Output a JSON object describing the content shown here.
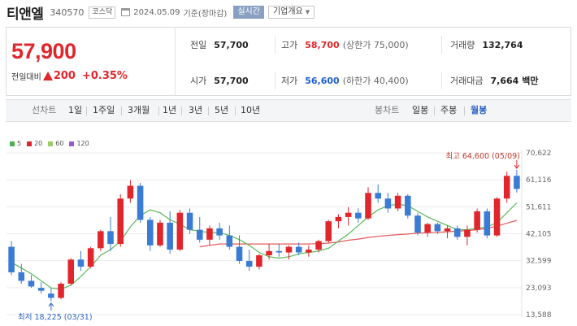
{
  "header": {
    "name": "티앤엘",
    "code": "340570",
    "market": "코스닥",
    "date": "2024.05.09",
    "basis": "기준(장마감)",
    "realtime_label": "실시간",
    "company_info_label": "기업개요"
  },
  "quote": {
    "price": "57,900",
    "change_label": "전일대비",
    "change": "200",
    "change_pct": "+0.35%",
    "prev_close_label": "전일",
    "prev_close": "57,700",
    "high_label": "고가",
    "high": "58,700",
    "upper_limit": "(상한가 75,000)",
    "volume_label": "거래량",
    "volume": "132,764",
    "open_label": "시가",
    "open": "57,700",
    "low_label": "저가",
    "low": "56,600",
    "lower_limit": "(하한가 40,400)",
    "amount_label": "거래대금",
    "amount": "7,664",
    "amount_unit": "백만"
  },
  "tabs": {
    "line_label": "선차트",
    "line_periods": [
      "1일",
      "1주일",
      "3개월",
      "1년",
      "3년",
      "5년",
      "10년"
    ],
    "candle_label": "봉차트",
    "candle_periods": [
      "일봉",
      "주봉",
      "월봉"
    ],
    "active_candle": "월봉"
  },
  "colors": {
    "up": "#e0262c",
    "down": "#3a7bd5",
    "accent": "#2b62c5",
    "ma5": "#4caf50",
    "ma20": "#e0262c",
    "ma60": "#9ccc65",
    "ma120": "#9c5bd1"
  },
  "chart_data": {
    "type": "candlestick",
    "legend": [
      {
        "name": "5",
        "color": "#4caf50"
      },
      {
        "name": "20",
        "color": "#e0262c"
      },
      {
        "name": "60",
        "color": "#9ccc65"
      },
      {
        "name": "120",
        "color": "#9c5bd1"
      }
    ],
    "y_ticks": [
      70622,
      61116,
      51611,
      42105,
      32599,
      23093,
      13588
    ],
    "y_tick_labels": [
      "70,622",
      "61,116",
      "51,611",
      "42,105",
      "32,599",
      "23,093",
      "13,588"
    ],
    "ylim": [
      13588,
      70622
    ],
    "high_annotation": "최고 64,600 (05/09)",
    "low_annotation": "최저 18,225 (03/31)",
    "candles": [
      [
        37500,
        39500,
        27500,
        28500
      ],
      [
        28500,
        31500,
        24500,
        25500
      ],
      [
        25500,
        27500,
        23000,
        23500
      ],
      [
        23000,
        25000,
        21000,
        22000
      ],
      [
        21000,
        23000,
        18225,
        19500
      ],
      [
        19500,
        25000,
        19000,
        24500
      ],
      [
        24500,
        33500,
        24000,
        33000
      ],
      [
        33000,
        36000,
        29000,
        30500
      ],
      [
        30500,
        37500,
        30000,
        37000
      ],
      [
        37000,
        43500,
        36000,
        43000
      ],
      [
        43000,
        48000,
        36000,
        38500
      ],
      [
        38500,
        56000,
        37500,
        54500
      ],
      [
        54500,
        61000,
        53000,
        59000
      ],
      [
        59000,
        60000,
        46000,
        47000
      ],
      [
        47000,
        48000,
        36000,
        38000
      ],
      [
        38000,
        47000,
        37500,
        46000
      ],
      [
        46000,
        50000,
        35000,
        36500
      ],
      [
        36500,
        50500,
        36000,
        49500
      ],
      [
        49500,
        51000,
        42000,
        43500
      ],
      [
        43500,
        48000,
        39000,
        40000
      ],
      [
        40000,
        45000,
        38000,
        44000
      ],
      [
        44000,
        46000,
        40000,
        41500
      ],
      [
        41500,
        45000,
        36500,
        37500
      ],
      [
        37500,
        41500,
        31500,
        32500
      ],
      [
        32500,
        36500,
        29000,
        30500
      ],
      [
        30500,
        35000,
        29500,
        34500
      ],
      [
        34500,
        38500,
        33000,
        36000
      ],
      [
        36000,
        38500,
        34000,
        35500
      ],
      [
        35500,
        38000,
        33000,
        37500
      ],
      [
        37500,
        39000,
        34500,
        35500
      ],
      [
        35500,
        38000,
        34000,
        36500
      ],
      [
        36500,
        40000,
        35500,
        39500
      ],
      [
        39500,
        47000,
        39000,
        46500
      ],
      [
        46500,
        49000,
        44000,
        48000
      ],
      [
        48000,
        51500,
        45000,
        49500
      ],
      [
        49500,
        51000,
        46000,
        47500
      ],
      [
        47500,
        58500,
        47000,
        56500
      ],
      [
        56500,
        59500,
        53000,
        54500
      ],
      [
        54500,
        56500,
        49500,
        51000
      ],
      [
        51000,
        56500,
        50000,
        55500
      ],
      [
        55500,
        56000,
        47500,
        48500
      ],
      [
        48500,
        49500,
        41500,
        42500
      ],
      [
        42500,
        46000,
        41000,
        45500
      ],
      [
        45500,
        46000,
        42000,
        43000
      ],
      [
        43000,
        45000,
        40500,
        44000
      ],
      [
        44000,
        45000,
        40000,
        41000
      ],
      [
        41000,
        45000,
        38000,
        43500
      ],
      [
        43500,
        51000,
        42500,
        50000
      ],
      [
        50000,
        51000,
        40500,
        41500
      ],
      [
        41500,
        55000,
        41000,
        54500
      ],
      [
        54500,
        64000,
        53000,
        62500
      ],
      [
        62500,
        64600,
        56600,
        57900
      ]
    ],
    "ma5": [
      32000,
      30000,
      28000,
      25500,
      23000,
      22500,
      24000,
      27000,
      30500,
      34500,
      36500,
      39500,
      44500,
      48500,
      50500,
      49500,
      47000,
      45500,
      43500,
      43000,
      42500,
      42500,
      41500,
      40000,
      38000,
      35500,
      34000,
      33500,
      34000,
      35000,
      35500,
      36000,
      37000,
      39500,
      42000,
      45000,
      48000,
      50500,
      52000,
      52500,
      52000,
      50000,
      48000,
      46500,
      45000,
      43500,
      43500,
      44000,
      44500,
      46000,
      49500,
      53000
    ],
    "ma20": [
      null,
      null,
      null,
      null,
      null,
      null,
      null,
      null,
      null,
      null,
      null,
      null,
      null,
      null,
      null,
      null,
      null,
      null,
      null,
      37500,
      38000,
      38500,
      38500,
      38500,
      38500,
      38500,
      38500,
      38500,
      38500,
      38500,
      38500,
      38600,
      38800,
      39200,
      39800,
      40200,
      40800,
      41200,
      41500,
      41800,
      42000,
      42300,
      42500,
      42600,
      42800,
      43000,
      43200,
      43500,
      44000,
      44800,
      45800,
      46800
    ]
  }
}
